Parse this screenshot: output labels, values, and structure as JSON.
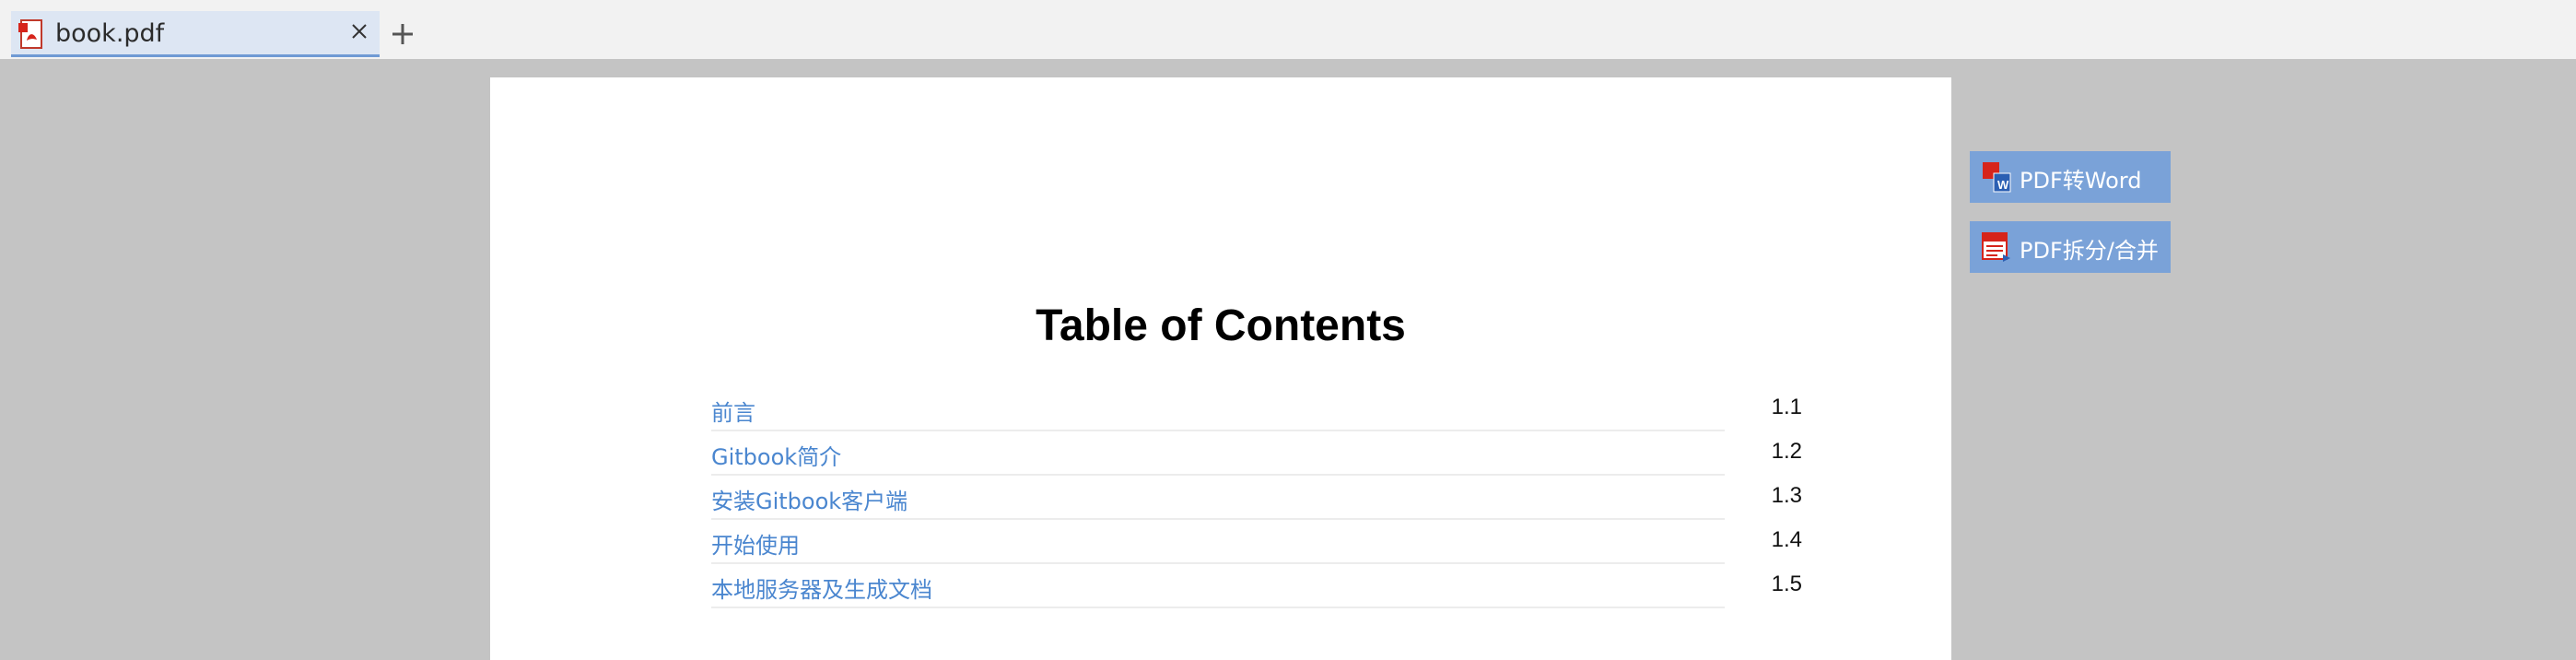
{
  "tabbar": {
    "tabs": [
      {
        "label": "book.pdf",
        "icon": "pdf-file-icon"
      }
    ],
    "close_icon": "close-icon",
    "new_tab_icon": "plus-icon"
  },
  "document": {
    "title": "Table of Contents",
    "toc": [
      {
        "label": "前言",
        "number": "1.1"
      },
      {
        "label": "Gitbook简介",
        "number": "1.2"
      },
      {
        "label": "安装Gitbook客户端",
        "number": "1.3"
      },
      {
        "label": "开始使用",
        "number": "1.4"
      },
      {
        "label": "本地服务器及生成文档",
        "number": "1.5"
      }
    ]
  },
  "side_buttons": {
    "pdf_to_word": {
      "label": "PDF转Word",
      "icon": "pdf-to-word-icon"
    },
    "pdf_split_merge": {
      "label": "PDF拆分/合并",
      "icon": "pdf-split-merge-icon"
    }
  },
  "colors": {
    "background": "#c4c4c4",
    "tab_active": "#dde6f3",
    "tab_underline": "#6f9ad4",
    "link": "#4a86cf",
    "side_button": "#7aa2d8"
  }
}
